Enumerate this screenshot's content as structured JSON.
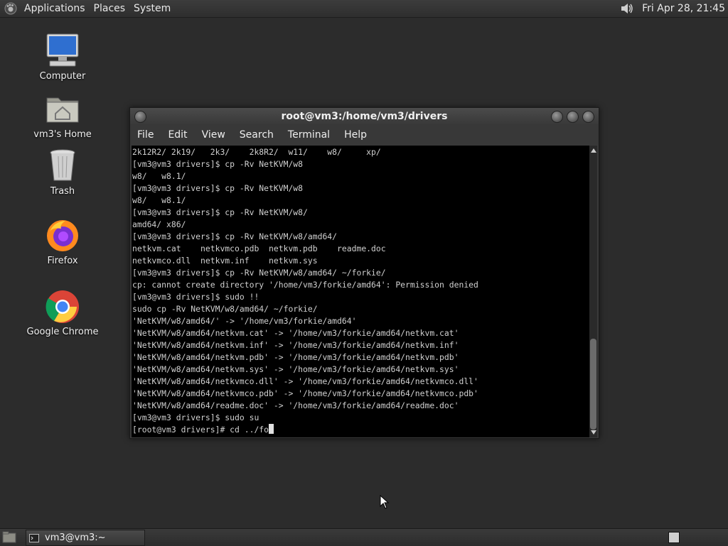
{
  "top_panel": {
    "menus": [
      "Applications",
      "Places",
      "System"
    ],
    "clock": "Fri Apr 28, 21:45",
    "logo_icon": "gnome-foot-icon",
    "volume_icon": "speaker-icon"
  },
  "desktop_icons": [
    {
      "label": "Computer",
      "icon": "computer-icon"
    },
    {
      "label": "vm3's Home",
      "icon": "home-folder-icon"
    },
    {
      "label": "Trash",
      "icon": "trash-icon"
    },
    {
      "label": "Firefox",
      "icon": "firefox-icon"
    },
    {
      "label": "Google Chrome",
      "icon": "chrome-icon"
    }
  ],
  "terminal": {
    "title": "root@vm3:/home/vm3/drivers",
    "menus": [
      "File",
      "Edit",
      "View",
      "Search",
      "Terminal",
      "Help"
    ],
    "lines": [
      "2k12R2/ 2k19/   2k3/    2k8R2/  w11/    w8/     xp/",
      "[vm3@vm3 drivers]$ cp -Rv NetKVM/w8",
      "w8/   w8.1/",
      "[vm3@vm3 drivers]$ cp -Rv NetKVM/w8",
      "w8/   w8.1/",
      "[vm3@vm3 drivers]$ cp -Rv NetKVM/w8/",
      "amd64/ x86/",
      "[vm3@vm3 drivers]$ cp -Rv NetKVM/w8/amd64/",
      "netkvm.cat    netkvmco.pdb  netkvm.pdb    readme.doc",
      "netkvmco.dll  netkvm.inf    netkvm.sys",
      "[vm3@vm3 drivers]$ cp -Rv NetKVM/w8/amd64/ ~/forkie/",
      "cp: cannot create directory '/home/vm3/forkie/amd64': Permission denied",
      "[vm3@vm3 drivers]$ sudo !!",
      "sudo cp -Rv NetKVM/w8/amd64/ ~/forkie/",
      "'NetKVM/w8/amd64/' -> '/home/vm3/forkie/amd64'",
      "'NetKVM/w8/amd64/netkvm.cat' -> '/home/vm3/forkie/amd64/netkvm.cat'",
      "'NetKVM/w8/amd64/netkvm.inf' -> '/home/vm3/forkie/amd64/netkvm.inf'",
      "'NetKVM/w8/amd64/netkvm.pdb' -> '/home/vm3/forkie/amd64/netkvm.pdb'",
      "'NetKVM/w8/amd64/netkvm.sys' -> '/home/vm3/forkie/amd64/netkvm.sys'",
      "'NetKVM/w8/amd64/netkvmco.dll' -> '/home/vm3/forkie/amd64/netkvmco.dll'",
      "'NetKVM/w8/amd64/netkvmco.pdb' -> '/home/vm3/forkie/amd64/netkvmco.pdb'",
      "'NetKVM/w8/amd64/readme.doc' -> '/home/vm3/forkie/amd64/readme.doc'",
      "[vm3@vm3 drivers]$ sudo su"
    ],
    "prompt_line": "[root@vm3 drivers]# cd ../fo"
  },
  "taskbar": {
    "window_label": "vm3@vm3:~",
    "show_desktop_icon": "show-desktop-icon",
    "terminal_icon": "terminal-icon"
  },
  "colors": {
    "desktop": "#2c2c2c",
    "panel": "#333333",
    "terminal_bg": "#000000",
    "terminal_fg": "#d0d0d0"
  }
}
